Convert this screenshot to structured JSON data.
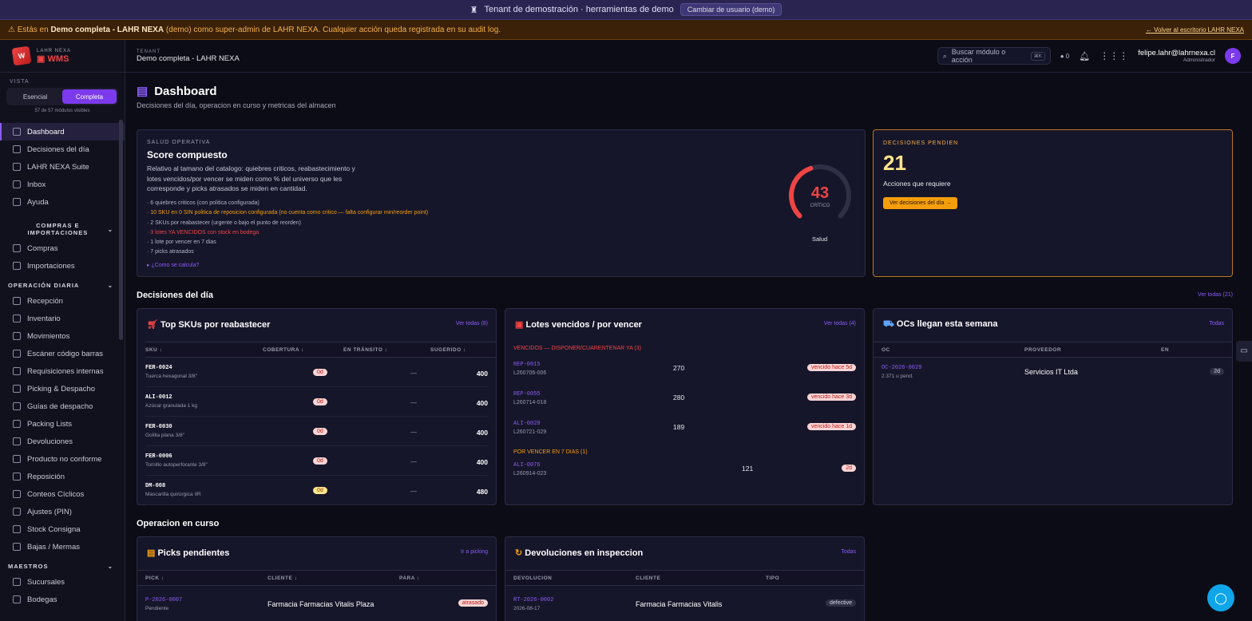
{
  "topbar": {
    "text": "Tenant de demostración · herramientas de demo",
    "switch_user": "Cambiar de usuario (demo)"
  },
  "warn": {
    "prefix": "Estás en",
    "tenant": "Demo completa - LAHR NEXA",
    "demo": "(demo)",
    "suffix": "como super-admin de LAHR NEXA. Cualquier acción queda registrada en su audit log.",
    "back": "← Volver al escritorio LAHR NEXA"
  },
  "brand": {
    "small": "LAHR NEXA",
    "wms": "WMS"
  },
  "vista": {
    "label": "VISTA",
    "esencial": "Esencial",
    "completa": "Completa",
    "count": "57 de 57 módulos visibles"
  },
  "nav": {
    "top": [
      "Dashboard",
      "Decisiones del día",
      "LAHR NEXA Suite",
      "Inbox",
      "Ayuda"
    ],
    "sec1": "COMPRAS E IMPORTACIONES",
    "sec1_items": [
      "Compras",
      "Importaciones"
    ],
    "sec2": "OPERACIÓN DIARIA",
    "sec2_items": [
      "Recepción",
      "Inventario",
      "Movimientos",
      "Escáner código barras",
      "Requisiciones internas",
      "Picking & Despacho",
      "Guías de despacho",
      "Packing Lists",
      "Devoluciones",
      "Producto no conforme",
      "Reposición",
      "Conteos Cíclicos",
      "Ajustes (PIN)",
      "Stock Consigna",
      "Bajas / Mermas"
    ],
    "sec3": "MAESTROS",
    "sec3_items": [
      "Sucursales",
      "Bodegas"
    ]
  },
  "header": {
    "tenant_label": "TENANT",
    "tenant_name": "Demo completa - LAHR NEXA",
    "search_placeholder": "Buscar módulo o acción",
    "kbd": "⌘K",
    "notif_count": "0",
    "email": "felipe.lahr@lahrnexa.cl",
    "role": "Administrador",
    "avatar": "F"
  },
  "page": {
    "title": "Dashboard",
    "subtitle": "Decisiones del día, operacion en curso y metricas del almacen"
  },
  "salud": {
    "label": "SALUD OPERATIVA",
    "title": "Score compuesto",
    "desc": "Relativo al tamano del catalogo: quiebres criticos, reabastecimiento y lotes vencidos/por vencer se miden como % del universo que les corresponde y picks atrasados se miden en cantidad.",
    "items": [
      "· 6 quiebres criticos (con politica configurada)",
      "· 10 SKU en 0 SIN politica de reposicion configurada (no cuenta como critico — falta configurar min/reorder point)",
      "· 2 SKUs por reabastecer (urgente o bajo el punto de reorden)",
      "· 3 lotes YA VENCIDOS con stock en bodega",
      "· 1 lote por vencer en 7 dias",
      "· 7 picks atrasados"
    ],
    "how": "▸ ¿Como se calcula?",
    "score": "43",
    "score_label": "CRÍTICO",
    "gauge_label": "Salud",
    "score_value": 0.43
  },
  "decisiones": {
    "label": "DECISIONES PENDIEN",
    "count": "21",
    "desc": "Acciones que requiere",
    "button": "Ver decisiones del día →"
  },
  "section_dia": {
    "title": "Decisiones del día",
    "link": "Ver todas (21)"
  },
  "reabastecer": {
    "title": "Top SKUs por reabastecer",
    "link": "Ver todas (8)",
    "headers": [
      "SKU ↕",
      "COBERTURA ↕",
      "EN TRÁNSITO ↕",
      "SUGERIDO ↕"
    ],
    "rows": [
      {
        "code": "FER-0024",
        "desc": "Tuerca hexagonal 3/8\"",
        "cov": "0d",
        "transit": "—",
        "sug": "400"
      },
      {
        "code": "ALI-0012",
        "desc": "Azúcar granulada 1 kg",
        "cov": "0d",
        "transit": "—",
        "sug": "400"
      },
      {
        "code": "FER-0030",
        "desc": "Golilla plana 3/8\"",
        "cov": "0d",
        "transit": "—",
        "sug": "400"
      },
      {
        "code": "FER-0006",
        "desc": "Tornillo autoperforante 3/8\"",
        "cov": "0d",
        "transit": "—",
        "sug": "400"
      },
      {
        "code": "DM-008",
        "desc": "Mascarilla quirúrgica IIR",
        "cov": "0d",
        "transit": "—",
        "sug": "480"
      }
    ]
  },
  "lotes": {
    "title": "Lotes vencidos / por vencer",
    "link": "Ver todas (4)",
    "vencidos_label": "VENCIDOS — DISPONER/CUARENTENAR YA (3)",
    "vencidos": [
      {
        "code": "REP-0015",
        "lot": "L260706-006",
        "qty": "270",
        "badge": "vencido hace 5d"
      },
      {
        "code": "REP-0055",
        "lot": "L260714-018",
        "qty": "280",
        "badge": "vencido hace 3d"
      },
      {
        "code": "ALI-0020",
        "lot": "L260721-029",
        "qty": "189",
        "badge": "vencido hace 1d"
      }
    ],
    "porvencer_label": "POR VENCER EN 7 DIAS (1)",
    "porvencer": [
      {
        "code": "ALI-0076",
        "lot": "L260914-023",
        "qty": "121",
        "badge": "2d"
      }
    ]
  },
  "ocs": {
    "title": "OCs llegan esta semana",
    "link": "Todas",
    "headers": [
      "OC",
      "PROVEEDOR",
      "EN"
    ],
    "row": {
      "code": "OC-2026-0029",
      "units": "2.371 u pend.",
      "prov": "Servicios IT Ltda",
      "en": "2d"
    }
  },
  "section_op": {
    "title": "Operacion en curso"
  },
  "picks": {
    "title": "Picks pendientes",
    "link": "Ir a picking",
    "headers": [
      "PICK ↕",
      "CLIENTE ↕",
      "PARA ↕"
    ],
    "row": {
      "code": "P-2026-0007",
      "state": "Pendiente",
      "client": "Farmacia Farmacias Vitalis Plaza",
      "badge": "atrasado"
    }
  },
  "devol": {
    "title": "Devoluciones en inspeccion",
    "link": "Todas",
    "headers": [
      "DEVOLUCION",
      "CLIENTE",
      "TIPO"
    ],
    "row": {
      "code": "RT-2026-0002",
      "date": "2026-08-17",
      "client": "Farmacia Farmacias Vitalis",
      "badge": "defective"
    }
  },
  "colors": {
    "accent": "#7c3aed",
    "danger": "#ef4444",
    "warn": "#f59e0b"
  }
}
